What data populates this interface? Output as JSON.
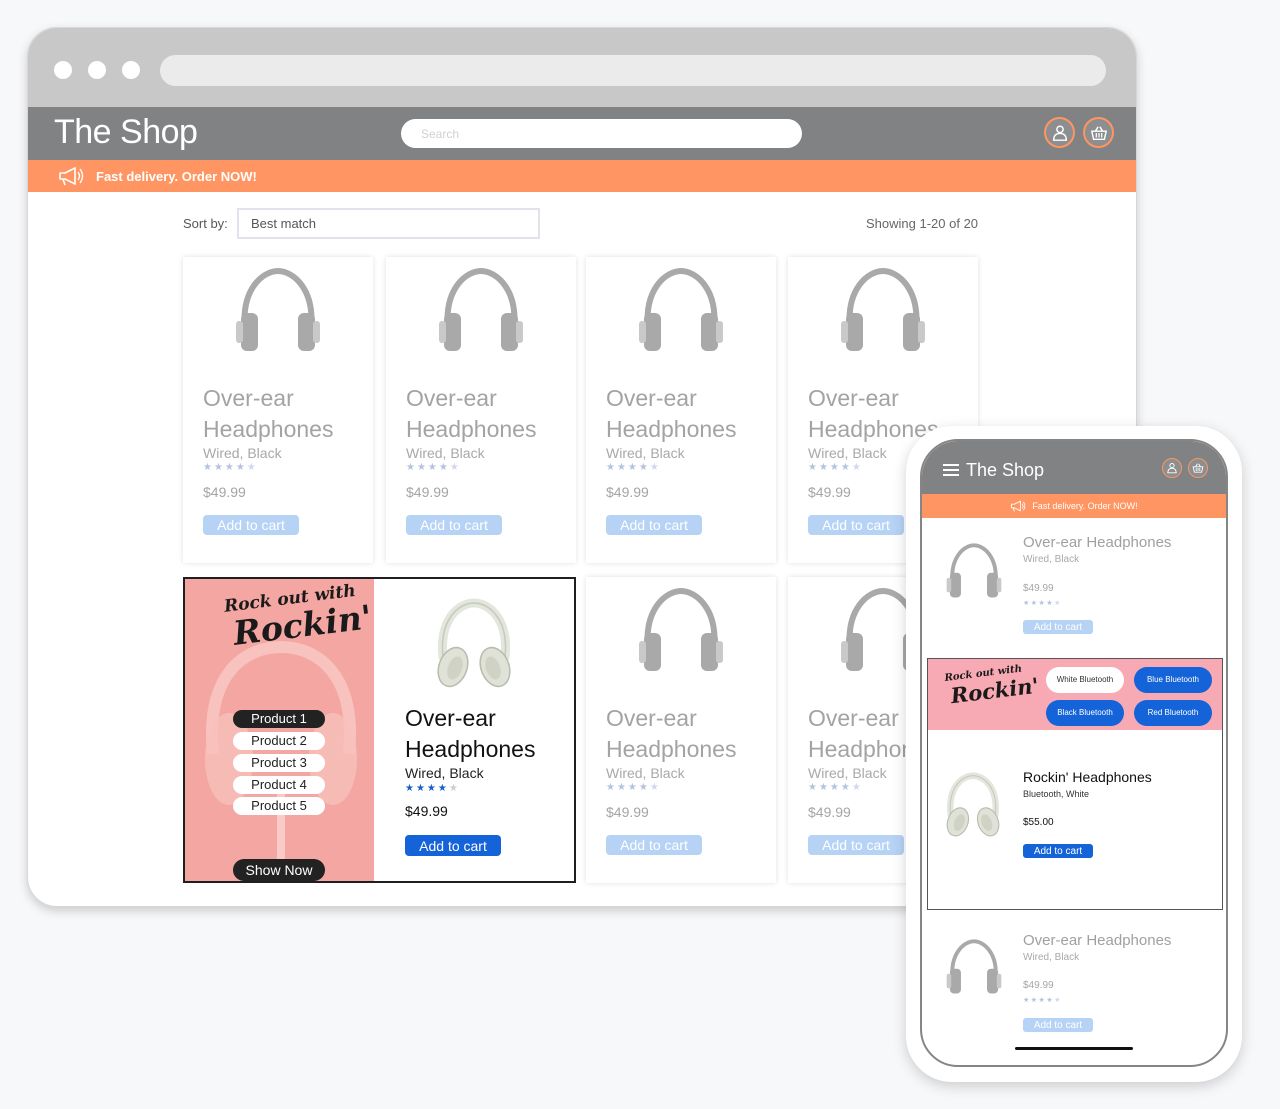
{
  "colors": {
    "header": "#808284",
    "accent": "#ff9562",
    "button": "#1463d8",
    "button_muted": "#b6d2f5"
  },
  "desktop": {
    "logo": "The Shop",
    "search_placeholder": "Search",
    "banner": "Fast delivery. Order NOW!",
    "sort_label": "Sort by:",
    "sort_value": "Best match",
    "showing": "Showing 1-20 of 20",
    "product": {
      "name": "Over-ear Headphones",
      "sub": "Wired, Black",
      "price": "$49.99",
      "cta": "Add to cart",
      "rating": 3.5
    },
    "promo": {
      "title_line1": "Rock out with",
      "title_line2": "Rockin'",
      "options": [
        "Product 1",
        "Product 2",
        "Product 3",
        "Product 4",
        "Product 5"
      ],
      "selected_option": "Product 1",
      "cta": "Show Now",
      "product_name": "Over-ear Headphones",
      "product_sub": "Wired, Black",
      "price": "$49.99",
      "add_cta": "Add to cart"
    }
  },
  "mobile": {
    "logo": "The Shop",
    "banner": "Fast delivery. Order NOW!",
    "item": {
      "name": "Over-ear Headphones",
      "sub": "Wired, Black",
      "price": "$49.99",
      "cta": "Add to cart"
    },
    "promo": {
      "title_line1": "Rock out with",
      "title_line2": "Rockin'",
      "chips": [
        "White Bluetooth",
        "Blue Bluetooth",
        "Black Bluetooth",
        "Red Bluetooth"
      ],
      "product_name": "Rockin' Headphones",
      "product_sub": "Bluetooth, White",
      "price": "$55.00",
      "cta": "Add to cart"
    }
  }
}
